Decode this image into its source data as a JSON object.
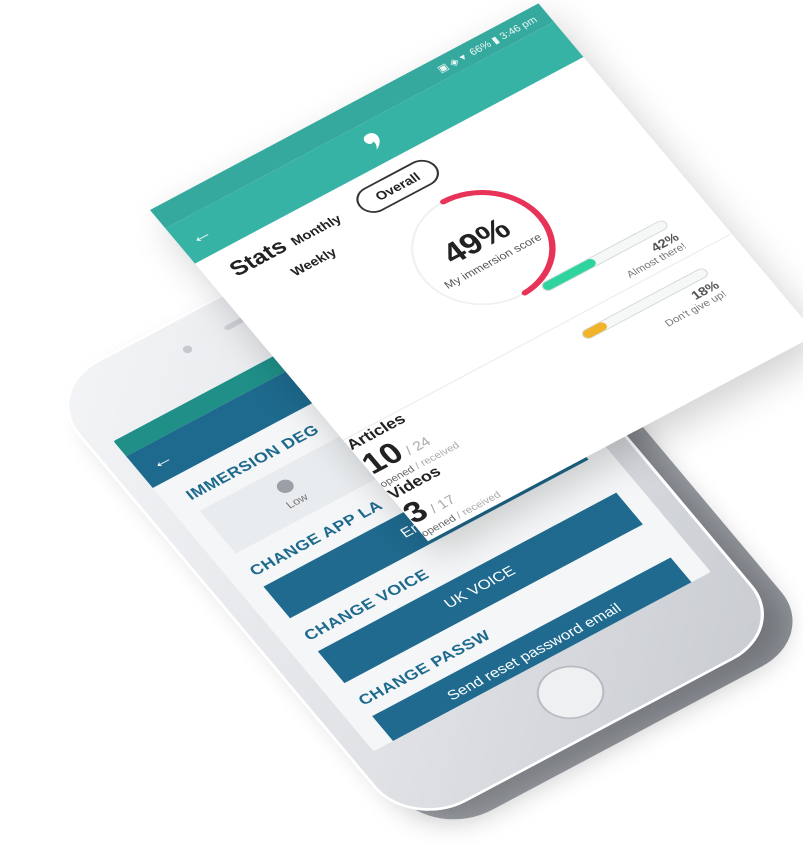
{
  "phone_screen": {
    "sections": {
      "immersion_degree": "IMMERSION DEG",
      "change_app_language": "CHANGE APP LA",
      "change_voice": "CHANGE VOICE",
      "change_password": "CHANGE PASSW"
    },
    "degree_low_label": "Low",
    "language_button": "English",
    "voice_button": "UK VOICE",
    "reset_button": "Send reset password email",
    "back_glyph": "←"
  },
  "stats": {
    "status_text": "66% ▮ 3:46 pm",
    "back_glyph": "←",
    "title": "Stats",
    "tabs": {
      "weekly": "Weekly",
      "monthly": "Monthly",
      "overall": "Overall"
    },
    "score": {
      "percent_text": "49%",
      "label": "My immersion score",
      "fraction": 0.49,
      "color": "#e83358"
    },
    "bar_1": {
      "percent_text": "42%",
      "message": "Almost there!",
      "fraction": 0.42,
      "color": "#2fd3a0"
    },
    "bar_2": {
      "percent_text": "18%",
      "message": "Don't give up!",
      "fraction": 0.18,
      "color": "#f0b32a"
    },
    "articles": {
      "title": "Articles",
      "value": "10",
      "total": "/ 24",
      "opened": "opened",
      "received": "/ received"
    },
    "videos": {
      "title": "Videos",
      "value": "3",
      "total": "/ 17",
      "opened": "opened",
      "received": "/ received"
    }
  },
  "colors": {
    "teal": "#37b3a6",
    "navy": "#1e6a8e"
  },
  "icons": [
    "back-arrow-icon",
    "app-logo-icon",
    "status-icons"
  ]
}
